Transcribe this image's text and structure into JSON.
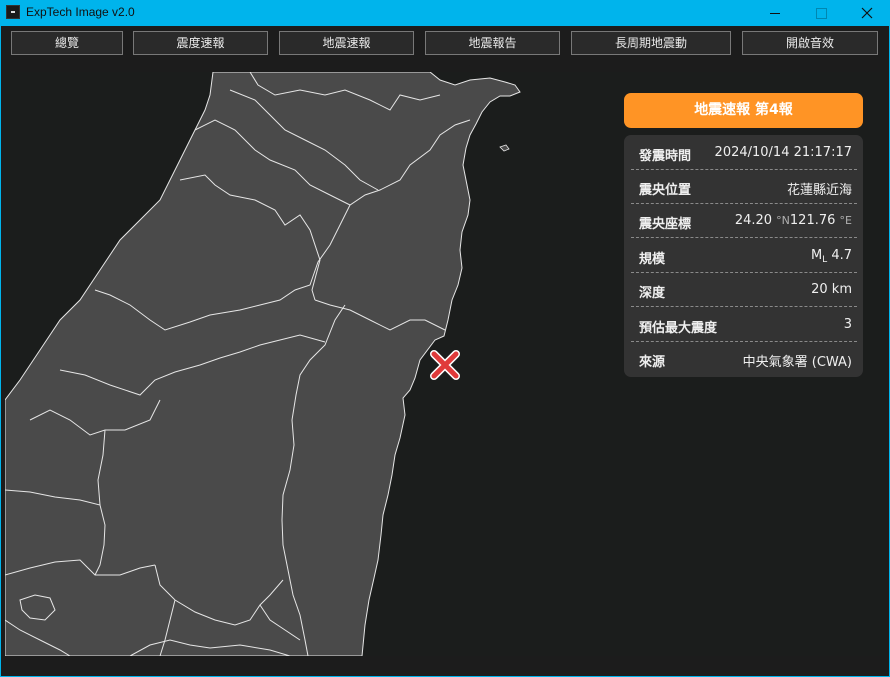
{
  "window": {
    "title": "ExpTech Image v2.0",
    "controls": {
      "minimize": "minimize",
      "maximize": "maximize",
      "close": "close"
    }
  },
  "toolbar": {
    "buttons": [
      {
        "label": "總覽"
      },
      {
        "label": "震度速報"
      },
      {
        "label": "地震速報"
      },
      {
        "label": "地震報告"
      },
      {
        "label": "長周期地震動"
      },
      {
        "label": "開啟音效"
      }
    ]
  },
  "report": {
    "header": "地震速報 第4報",
    "accent_color": "#ff9425",
    "rows": {
      "time": {
        "label": "發震時間",
        "value": "2024/10/14 21:17:17"
      },
      "location": {
        "label": "震央位置",
        "value": "花蓮縣近海"
      },
      "coords": {
        "label": "震央座標",
        "lat": "24.20",
        "lat_unit": "°N",
        "lon": "121.76",
        "lon_unit": "°E"
      },
      "magnitude": {
        "label": "規模",
        "prefix": "M",
        "sub": "L",
        "value": "4.7"
      },
      "depth": {
        "label": "深度",
        "value": "20 km"
      },
      "intensity": {
        "label": "預估最大震度",
        "value": "3"
      },
      "source": {
        "label": "來源",
        "value": "中央氣象署 (CWA)"
      }
    }
  },
  "map": {
    "land_color": "#4a4a4a",
    "sea_color": "#1b1d1c",
    "border_color": "#e6e6e6",
    "epicenter_icon": "x-cross-icon",
    "epicenter_color": "#e03a3a"
  }
}
